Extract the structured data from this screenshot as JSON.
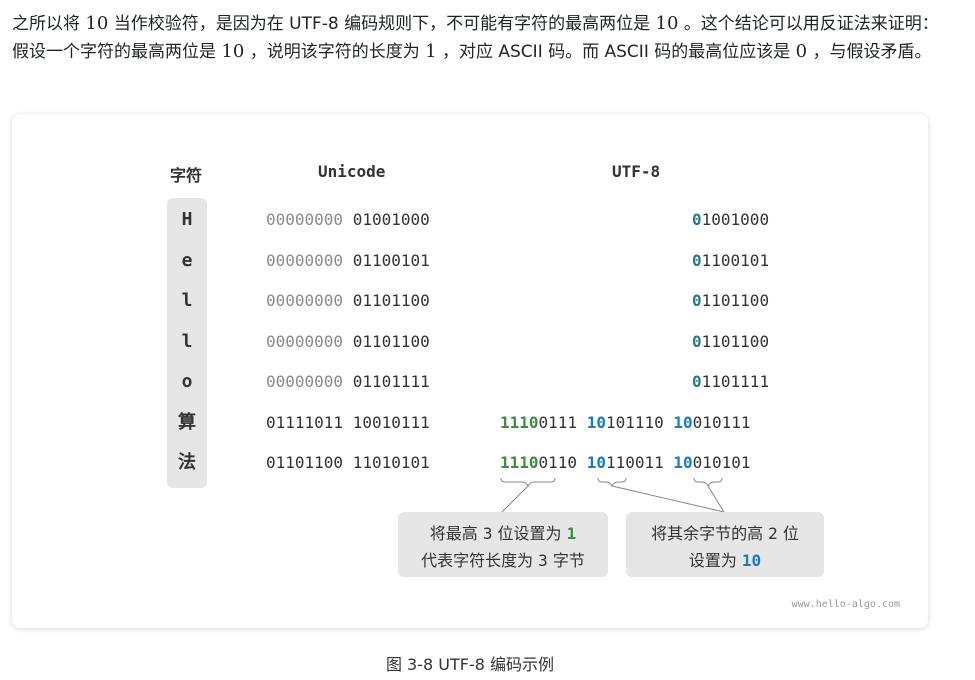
{
  "paragraph": {
    "p1": "之所以将",
    "n1": "10",
    "p2": "当作校验符，是因为在 UTF-8 编码规则下，不可能有字符的最高两位是",
    "n2": "10",
    "p3": "。这个结论可以用反证法来证明：假设一个字符的最高两位是",
    "n3": "10",
    "p4": "，说明该字符的长度为",
    "n4": "1",
    "p5": "，对应 ASCII 码。而 ASCII 码的最高位应该是",
    "n5": "0",
    "p6": "，与假设矛盾。"
  },
  "headers": {
    "char": "字符",
    "unicode": "Unicode",
    "utf8": "UTF-8"
  },
  "rows": [
    {
      "char": "H",
      "uni_hi": "00000000",
      "uni_lo": "01001000",
      "utf_prefix": "0",
      "utf_rest": "1001000"
    },
    {
      "char": "e",
      "uni_hi": "00000000",
      "uni_lo": "01100101",
      "utf_prefix": "0",
      "utf_rest": "1100101"
    },
    {
      "char": "l",
      "uni_hi": "00000000",
      "uni_lo": "01101100",
      "utf_prefix": "0",
      "utf_rest": "1101100"
    },
    {
      "char": "l",
      "uni_hi": "00000000",
      "uni_lo": "01101100",
      "utf_prefix": "0",
      "utf_rest": "1101100"
    },
    {
      "char": "o",
      "uni_hi": "00000000",
      "uni_lo": "01101111",
      "utf_prefix": "0",
      "utf_rest": "1101111"
    },
    {
      "char": "算",
      "uni_hi": "01111011",
      "uni_lo": "10010111",
      "b1_prefix": "1110",
      "b1_rest": "0111",
      "b2_prefix": "10",
      "b2_rest": "101110",
      "b3_prefix": "10",
      "b3_rest": "010111"
    },
    {
      "char": "法",
      "uni_hi": "01101100",
      "uni_lo": "11010101",
      "b1_prefix": "1110",
      "b1_rest": "0110",
      "b2_prefix": "10",
      "b2_rest": "110011",
      "b3_prefix": "10",
      "b3_rest": "010101"
    }
  ],
  "notes": {
    "left_line1_a": "将最高",
    "left_line1_n": "3",
    "left_line1_b": "位设置为",
    "left_line1_hl": "1",
    "left_line2_a": "代表字符长度为",
    "left_line2_n": "3",
    "left_line2_b": "字节",
    "right_line1_a": "将其余字节的高",
    "right_line1_n": "2",
    "right_line1_b": "位",
    "right_line2_a": "设置为",
    "right_line2_hl": "10"
  },
  "colors": {
    "single_byte_prefix": "#2b7a87",
    "lead_byte_prefix": "#3b8e3e",
    "continuation_prefix": "#1c7ac2"
  },
  "watermark": "www.hello-algo.com",
  "caption": "图 3-8 UTF-8 编码示例"
}
